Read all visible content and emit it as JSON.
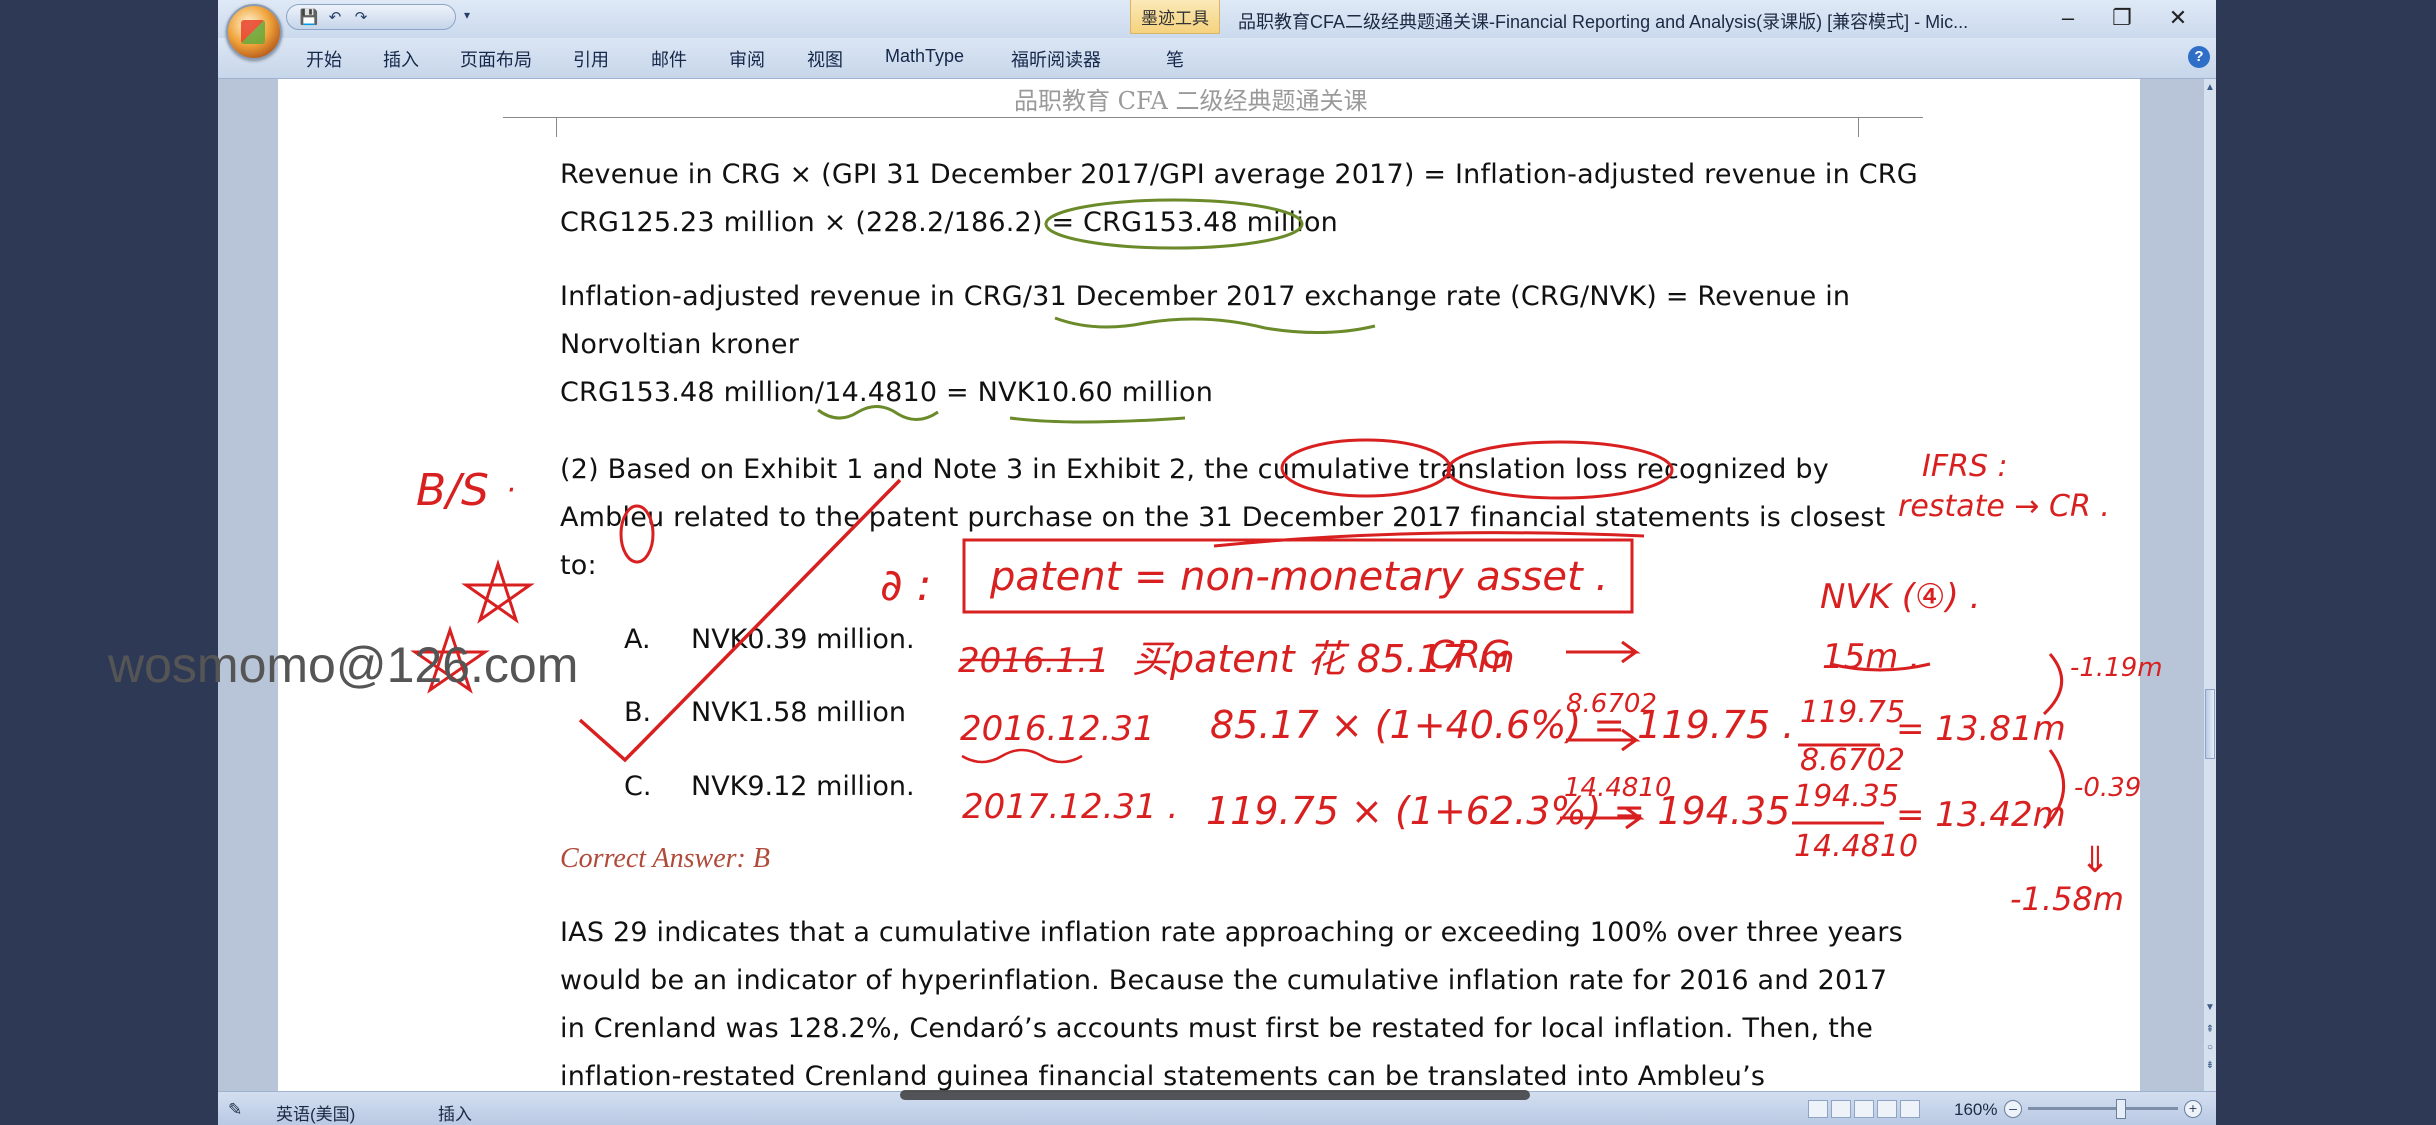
{
  "window": {
    "title": "品职教育CFA二级经典题通关课-Financial Reporting and Analysis(录课版) [兼容模式] - Mic...",
    "context_tab": "墨迹工具",
    "controls": [
      "–",
      "❐",
      "✕"
    ]
  },
  "qat": {
    "save": "💾",
    "undo": "↶",
    "redo": "↷"
  },
  "ribbon": {
    "tabs": [
      "开始",
      "插入",
      "页面布局",
      "引用",
      "邮件",
      "审阅",
      "视图",
      "MathType",
      "福昕阅读器",
      "笔"
    ]
  },
  "page": {
    "header": "品职教育 CFA 二级经典题通关课",
    "lines": {
      "l1": "Revenue in CRG × (GPI 31 December 2017/GPI average 2017) = Inflation-adjusted revenue in CRG",
      "l2": "CRG125.23 million × (228.2/186.2) = CRG153.48 million",
      "l3": "Inflation-adjusted revenue in CRG/31 December 2017 exchange rate (CRG/NVK) = Revenue in",
      "l4": "Norvoltian kroner",
      "l5": "CRG153.48 million/14.4810 = NVK10.60 million",
      "q1": "(2) Based on Exhibit 1 and Note 3 in Exhibit 2, the cumulative translation loss recognized by",
      "q2": "Ambleu related to the patent purchase on the 31 December 2017 financial statements is closest",
      "q3": "to:",
      "e1": "IAS 29 indicates that a cumulative inflation rate approaching or exceeding 100% over three years",
      "e2": "would be an indicator of hyperinflation. Because the cumulative inflation rate for 2016 and 2017",
      "e3": "in Crenland was 128.2%, Cendaró’s accounts must first be restated for local inflation. Then, the",
      "e4": "inflation-restated Crenland guinea financial statements can be translated into Ambleu’s"
    },
    "options": [
      {
        "letter": "A.",
        "text": "NVK0.39 million."
      },
      {
        "letter": "B.",
        "text": "NVK1.58 million"
      },
      {
        "letter": "C.",
        "text": "NVK9.12 million."
      }
    ],
    "correct_answer": "Correct Answer: B",
    "para_mark": "↵"
  },
  "handwriting": {
    "bs": "B/S",
    "dot": "·",
    "ifrs": "IFRS :",
    "restate": "restate → CR .",
    "marker": "∂ :",
    "patent_note": "patent = non-monetary asset .",
    "nvk_label": "NVK (④) .",
    "d1": "2016.1.1",
    "d1_note": "买patent 花 85.17 m",
    "crg": "CRG",
    "v1": "15m .",
    "d2": "2016.12.31",
    "calc2": "85.17 × (1+40.6%) = 119.75 .",
    "rate2": "8.6702",
    "frac2_num": "119.75",
    "frac2_den": "8.6702",
    "res2": "= 13.81m",
    "d3": "2017.12.31 .",
    "calc3": "119.75 × (1+62.3%) = 194.35",
    "rate3": "14.4810",
    "frac3_num": "194.35",
    "frac3_den": "14.4810",
    "res3": "= 13.42m",
    "diff1": "-1.19m",
    "diff2": "-0.39",
    "arrow_down": "⇓",
    "total": "-1.58m"
  },
  "watermark": "wosmomo@126.com",
  "statusbar": {
    "lang": "英语(美国)",
    "mode": "插入",
    "zoom": "160%"
  },
  "colors": {
    "ink_red": "#d92020",
    "ink_green": "#6b8a2a",
    "answer": "#b04a3a"
  }
}
